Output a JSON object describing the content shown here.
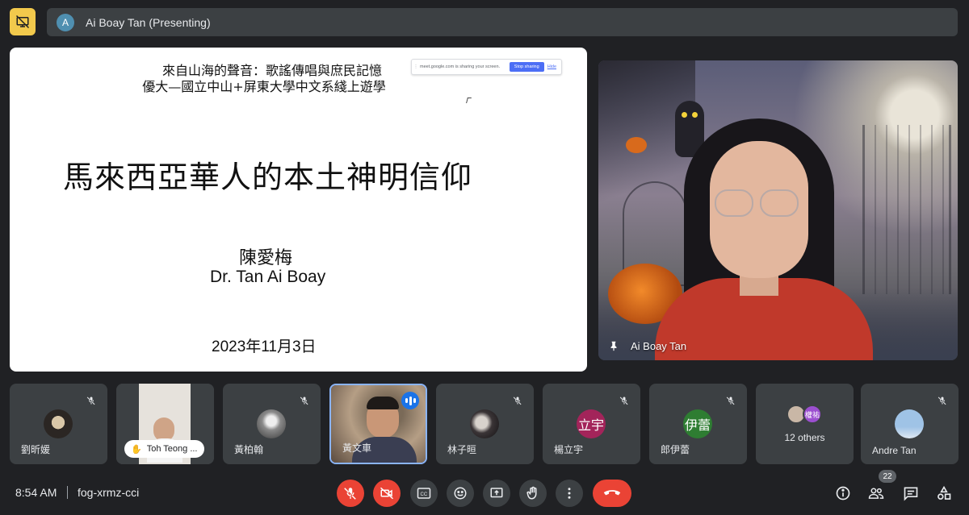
{
  "top": {
    "presenter_initial": "A",
    "presenter_label": "Ai Boay Tan (Presenting)"
  },
  "slide": {
    "header_line1": "來自山海的聲音：歌謠傳唱與庶民記憶",
    "header_line2": "優大—國立中山+屏東大學中文系綫上遊學",
    "title": "馬來西亞華人的本土神明信仰",
    "author_zh": "陳愛梅",
    "author_en": "Dr. Tan Ai Boay",
    "date": "2023年11月3日",
    "share_bar": {
      "text": "meet.google.com is sharing your screen.",
      "stop_label": "Stop sharing",
      "hide_label": "Hide"
    }
  },
  "speaker": {
    "name": "Ai Boay Tan"
  },
  "participants": [
    {
      "name": "劉昕媛",
      "muted": true,
      "avatar": "photo"
    },
    {
      "name": "Toh Teong ...",
      "muted": false,
      "avatar": "video",
      "hand_raised": true
    },
    {
      "name": "黃柏翰",
      "muted": true,
      "avatar": "photo"
    },
    {
      "name": "黃文車",
      "muted": false,
      "avatar": "video",
      "speaking": true
    },
    {
      "name": "林子晅",
      "muted": true,
      "avatar": "photo"
    },
    {
      "name": "楊立宇",
      "muted": true,
      "avatar_letter": "立宇",
      "avatar_color": "#a3245a"
    },
    {
      "name": "郎伊蕾",
      "muted": true,
      "avatar_letter": "伊蕾",
      "avatar_color": "#2e7d32"
    },
    {
      "name": "12 others",
      "avatar_letter": "權祐",
      "avatar_color": "#9c4fd0"
    },
    {
      "name": "Andre Tan",
      "muted": true,
      "avatar": "photo"
    }
  ],
  "bottom": {
    "time": "8:54 AM",
    "meeting_code": "fog-xrmz-cci",
    "participants_count": "22",
    "controls": [
      "mic-off-icon",
      "camera-off-icon",
      "captions-icon",
      "emoji-icon",
      "present-icon",
      "raise-hand-icon",
      "more-icon",
      "hangup-icon"
    ],
    "right_controls": [
      "info-icon",
      "people-icon",
      "chat-icon",
      "activities-icon"
    ]
  },
  "colors": {
    "background": "#202124",
    "tile": "#3c4043",
    "danger": "#ea4335",
    "accent": "#8ab4f8",
    "highlight": "#f2c94c"
  }
}
